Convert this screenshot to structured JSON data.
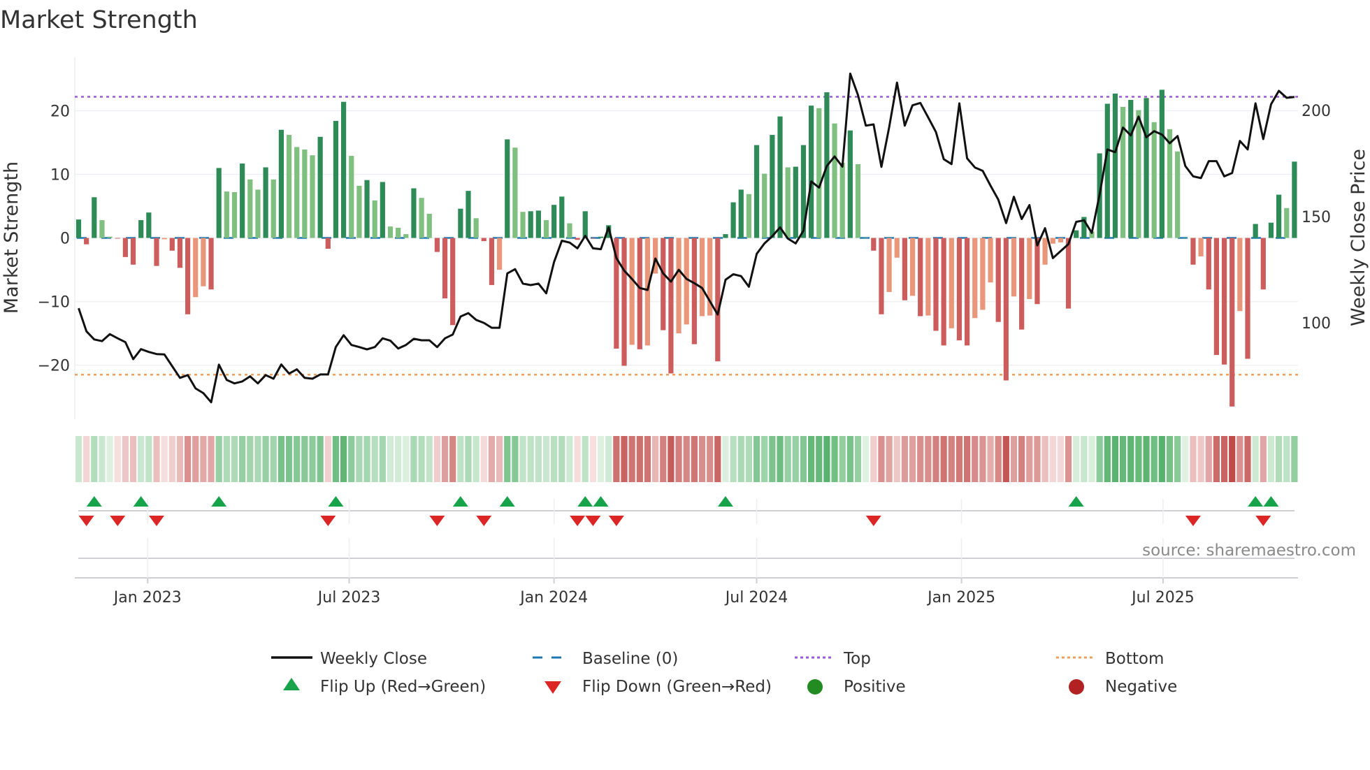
{
  "title": "Market Strength",
  "source": "source: sharemaestro.com",
  "colors": {
    "bar_pos_strong": "#2e8b57",
    "bar_pos_weak": "#7fbf7f",
    "bar_neg_strong": "#cd5c5c",
    "bar_neg_weak": "#e9967a",
    "price": "#111111",
    "baseline": "#1f77b4",
    "top": "#9b59d6",
    "bottom": "#f0a05a",
    "flip_up": "#16a34a",
    "flip_down": "#dc2626",
    "positive": "#228b22",
    "negative": "#b22222"
  },
  "legend": {
    "weekly_close": "Weekly Close",
    "baseline": "Baseline (0)",
    "top": "Top",
    "bottom": "Bottom",
    "flip_up": "Flip Up (Red→Green)",
    "flip_down": "Flip Down (Green→Red)",
    "positive": "Positive",
    "negative": "Negative"
  },
  "chart_data": {
    "type": "bar",
    "title": "Market Strength",
    "ylabel": "Market Strength",
    "y2label": "Weekly Close Price",
    "xlabel": "",
    "x_start": "2022-10-31",
    "x_interval_days": 7,
    "ylim": [
      -28.5,
      28.4
    ],
    "y2lim": [
      54.5,
      225
    ],
    "yticks": [
      -20,
      -10,
      0,
      10,
      20
    ],
    "yticklabels": [
      "−20",
      "−10",
      "0",
      "10",
      "20"
    ],
    "y2ticks": [
      100,
      150,
      200
    ],
    "y2ticklabels": [
      "100",
      "150",
      "200"
    ],
    "xticks": [
      {
        "date": "2023-01-01",
        "label": "Jan 2023"
      },
      {
        "date": "2023-07-01",
        "label": "Jul 2023"
      },
      {
        "date": "2024-01-01",
        "label": "Jan 2024"
      },
      {
        "date": "2024-07-01",
        "label": "Jul 2024"
      },
      {
        "date": "2025-01-01",
        "label": "Jan 2025"
      },
      {
        "date": "2025-07-01",
        "label": "Jul 2025"
      }
    ],
    "top_level": 22.2,
    "bottom_level": -21.5,
    "baseline": 0,
    "grid": true,
    "legend_position": "bottom",
    "series": [
      {
        "name": "Market Strength",
        "type": "bar",
        "values": [
          2.9,
          -1.0,
          6.4,
          2.8,
          0.2,
          -0.1,
          -3.0,
          -4.2,
          2.8,
          4.0,
          -4.4,
          -0.2,
          -2.0,
          -4.7,
          -12.0,
          -9.3,
          -7.6,
          -8.1,
          11.0,
          7.3,
          7.2,
          11.7,
          9.2,
          7.6,
          11.1,
          9.2,
          17.0,
          16.2,
          14.3,
          13.9,
          13.0,
          15.9,
          -1.7,
          18.4,
          21.4,
          12.9,
          8.2,
          9.1,
          5.9,
          8.8,
          1.8,
          1.6,
          0.6,
          7.8,
          6.3,
          3.8,
          -2.2,
          -9.5,
          -13.7,
          4.6,
          7.4,
          3.1,
          -0.5,
          -7.4,
          -5.0,
          15.5,
          14.2,
          4.1,
          4.2,
          4.3,
          2.8,
          5.2,
          6.5,
          2.3,
          -0.3,
          4.2,
          -0.1,
          0.2,
          2.0,
          -17.4,
          -20.1,
          -16.8,
          -17.5,
          -16.9,
          -5.6,
          -14.5,
          -21.3,
          -15.0,
          -13.6,
          -16.7,
          -12.3,
          -12.2,
          -19.4,
          0.6,
          5.6,
          7.6,
          6.9,
          14.6,
          10.1,
          16.2,
          19.1,
          11.1,
          11.2,
          14.6,
          20.8,
          20.4,
          22.9,
          18.0,
          11.8,
          16.9,
          11.6,
          0.05,
          -2.0,
          -12.0,
          -8.5,
          -3.1,
          -9.8,
          -9.1,
          -12.3,
          -12.2,
          -14.6,
          -16.9,
          -14.2,
          -16.1,
          -16.9,
          -12.6,
          -11.3,
          -7.0,
          -13.2,
          -22.4,
          -9.2,
          -14.4,
          -9.6,
          -10.4,
          -4.2,
          -0.9,
          -0.7,
          -11.1,
          1.2,
          3.3,
          1.0,
          13.3,
          21.1,
          22.7,
          20.6,
          21.7,
          20.1,
          22.0,
          18.2,
          23.3,
          17.1,
          13.6,
          0.05,
          -4.2,
          -2.9,
          -8.1,
          -18.4,
          -19.9,
          -26.5,
          -11.5,
          -19.0,
          2.2,
          -8.1,
          2.4,
          6.8,
          4.7,
          12.0
        ]
      },
      {
        "name": "Weekly Close",
        "type": "line",
        "axis": "right",
        "values": [
          106.8,
          95.9,
          92.1,
          91.3,
          94.6,
          92.6,
          90.8,
          82.8,
          87.5,
          86.2,
          85.2,
          85.0,
          79.5,
          74.0,
          75.3,
          69.0,
          66.8,
          62.5,
          80.2,
          73.0,
          71.4,
          72.3,
          74.7,
          71.4,
          75.3,
          73.6,
          80.3,
          76.0,
          78.0,
          74.0,
          73.6,
          75.6,
          75.6,
          88.5,
          94.1,
          89.5,
          88.5,
          87.4,
          88.5,
          92.6,
          91.5,
          87.8,
          89.5,
          92.4,
          91.7,
          91.7,
          88.5,
          92.6,
          94.4,
          102.9,
          104.5,
          101.3,
          99.9,
          97.6,
          97.6,
          123.2,
          125.2,
          118.4,
          117.7,
          118.4,
          113.8,
          128.5,
          138.6,
          137.7,
          135.0,
          140.9,
          135.0,
          134.6,
          144.9,
          130.4,
          124.5,
          120.6,
          116.3,
          115.4,
          130.2,
          123.2,
          119.3,
          124.9,
          120.6,
          118.6,
          116.3,
          110.1,
          103.8,
          120.2,
          122.8,
          121.9,
          116.9,
          132.4,
          137.3,
          140.7,
          144.9,
          139.6,
          137.3,
          143.3,
          166.5,
          163.6,
          173.8,
          178.3,
          173.5,
          217.3,
          207.2,
          192.8,
          193.4,
          173.4,
          192.1,
          213.1,
          192.8,
          202.4,
          203.5,
          196.7,
          189.8,
          177.0,
          174.7,
          203.3,
          177.4,
          173.1,
          171.5,
          164.6,
          158.0,
          146.9,
          159.3,
          148.8,
          155.4,
          136.4,
          144.5,
          130.4,
          133.7,
          137.0,
          147.5,
          148.2,
          142.3,
          160.4,
          181.6,
          180.3,
          191.9,
          188.2,
          197.1,
          187.3,
          190.2,
          188.6,
          184.5,
          187.9,
          173.8,
          168.9,
          168.1,
          176.1,
          176.1,
          168.9,
          170.5,
          185.6,
          181.6,
          203.3,
          186.5,
          202.9,
          209.2,
          205.9,
          206.3
        ]
      }
    ]
  }
}
